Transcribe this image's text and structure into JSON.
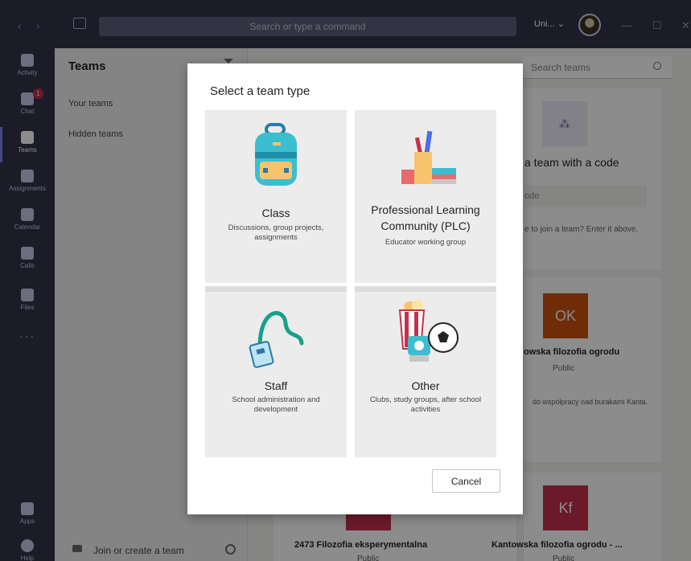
{
  "titlebar": {
    "search_placeholder": "Search or type a command",
    "org_label": "Uni...",
    "back_icon": "‹",
    "forward_icon": "›",
    "minimize_icon": "—",
    "maximize_icon": "☐",
    "close_icon": "✕"
  },
  "rail": {
    "items": [
      {
        "label": "Activity",
        "icon": "bell-icon"
      },
      {
        "label": "Chat",
        "icon": "chat-icon",
        "badge": "1"
      },
      {
        "label": "Teams",
        "icon": "teams-icon"
      },
      {
        "label": "Assignments",
        "icon": "assignments-icon"
      },
      {
        "label": "Calendar",
        "icon": "calendar-icon"
      },
      {
        "label": "Calls",
        "icon": "phone-icon"
      },
      {
        "label": "Files",
        "icon": "file-icon"
      }
    ],
    "more": "···",
    "apps": "Apps",
    "help": "Help",
    "accent": "#7f85f5"
  },
  "teams_panel": {
    "title": "Teams",
    "your_teams": "Your teams",
    "hidden_teams": "Hidden teams",
    "join_create": "Join or create a team"
  },
  "main": {
    "search_placeholder": "Search teams",
    "join_with_code": "a team with a code",
    "code_placeholder": "ode",
    "join_hint": "e to join a team? Enter it above.",
    "team1_initials": "OK",
    "team1_name": "owska filozofia ogrodu",
    "team1_privacy": "Public",
    "team1_desc": "do współpracy nad burakami Kanta.",
    "team2_name": "2473 Filozofia eksperymentalna",
    "team2_privacy": "Public",
    "team3_initials": "Kf",
    "team3_name": "Kantowska filozofia ogrodu - ...",
    "team3_privacy": "Public"
  },
  "modal": {
    "title": "Select a team type",
    "options": [
      {
        "name": "Class",
        "description": "Discussions, group projects, assignments",
        "illustration": "backpack-icon"
      },
      {
        "name": "Professional Learning Community (PLC)",
        "description": "Educator working group",
        "illustration": "books-pencils-icon"
      },
      {
        "name": "Staff",
        "description": "School administration and development",
        "illustration": "lanyard-badge-icon"
      },
      {
        "name": "Other",
        "description": "Clubs, study groups, after school activities",
        "illustration": "popcorn-camera-ball-icon"
      }
    ],
    "cancel_label": "Cancel"
  }
}
